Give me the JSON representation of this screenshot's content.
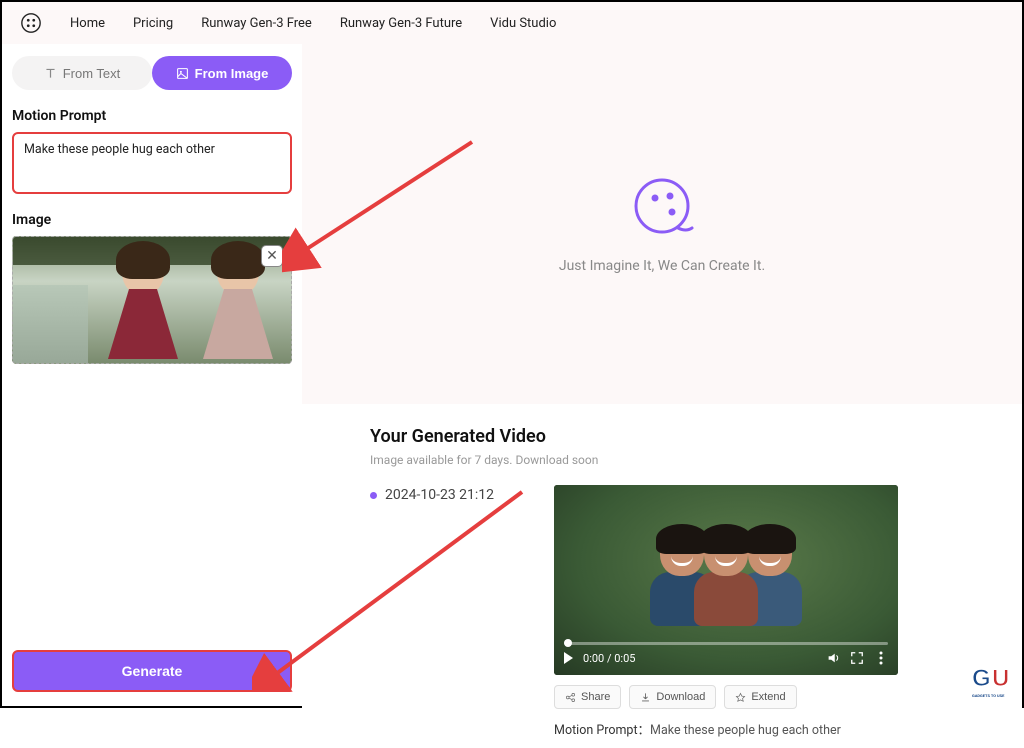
{
  "nav": {
    "items": [
      "Home",
      "Pricing",
      "Runway Gen-3 Free",
      "Runway Gen-3 Future",
      "Vidu Studio"
    ]
  },
  "modes": {
    "text": "From Text",
    "image": "From Image"
  },
  "prompt": {
    "label": "Motion Prompt",
    "value": "Make these people hug each other"
  },
  "imageSection": {
    "label": "Image"
  },
  "generate": {
    "label": "Generate"
  },
  "hero": {
    "tagline": "Just Imagine It, We Can Create It."
  },
  "generated": {
    "title": "Your Generated Video",
    "sub": "Image available for 7 days. Download soon",
    "timestamp": "2024-10-23 21:12",
    "time": "0:00 / 0:05",
    "actions": {
      "share": "Share",
      "download": "Download",
      "extend": "Extend"
    },
    "captionLabel": "Motion Prompt：",
    "captionText": "Make these people hug each other"
  },
  "watermark": {
    "text": "GADGETS TO USE"
  },
  "colors": {
    "accent": "#8b5cf6",
    "highlight": "#e53e3e"
  }
}
